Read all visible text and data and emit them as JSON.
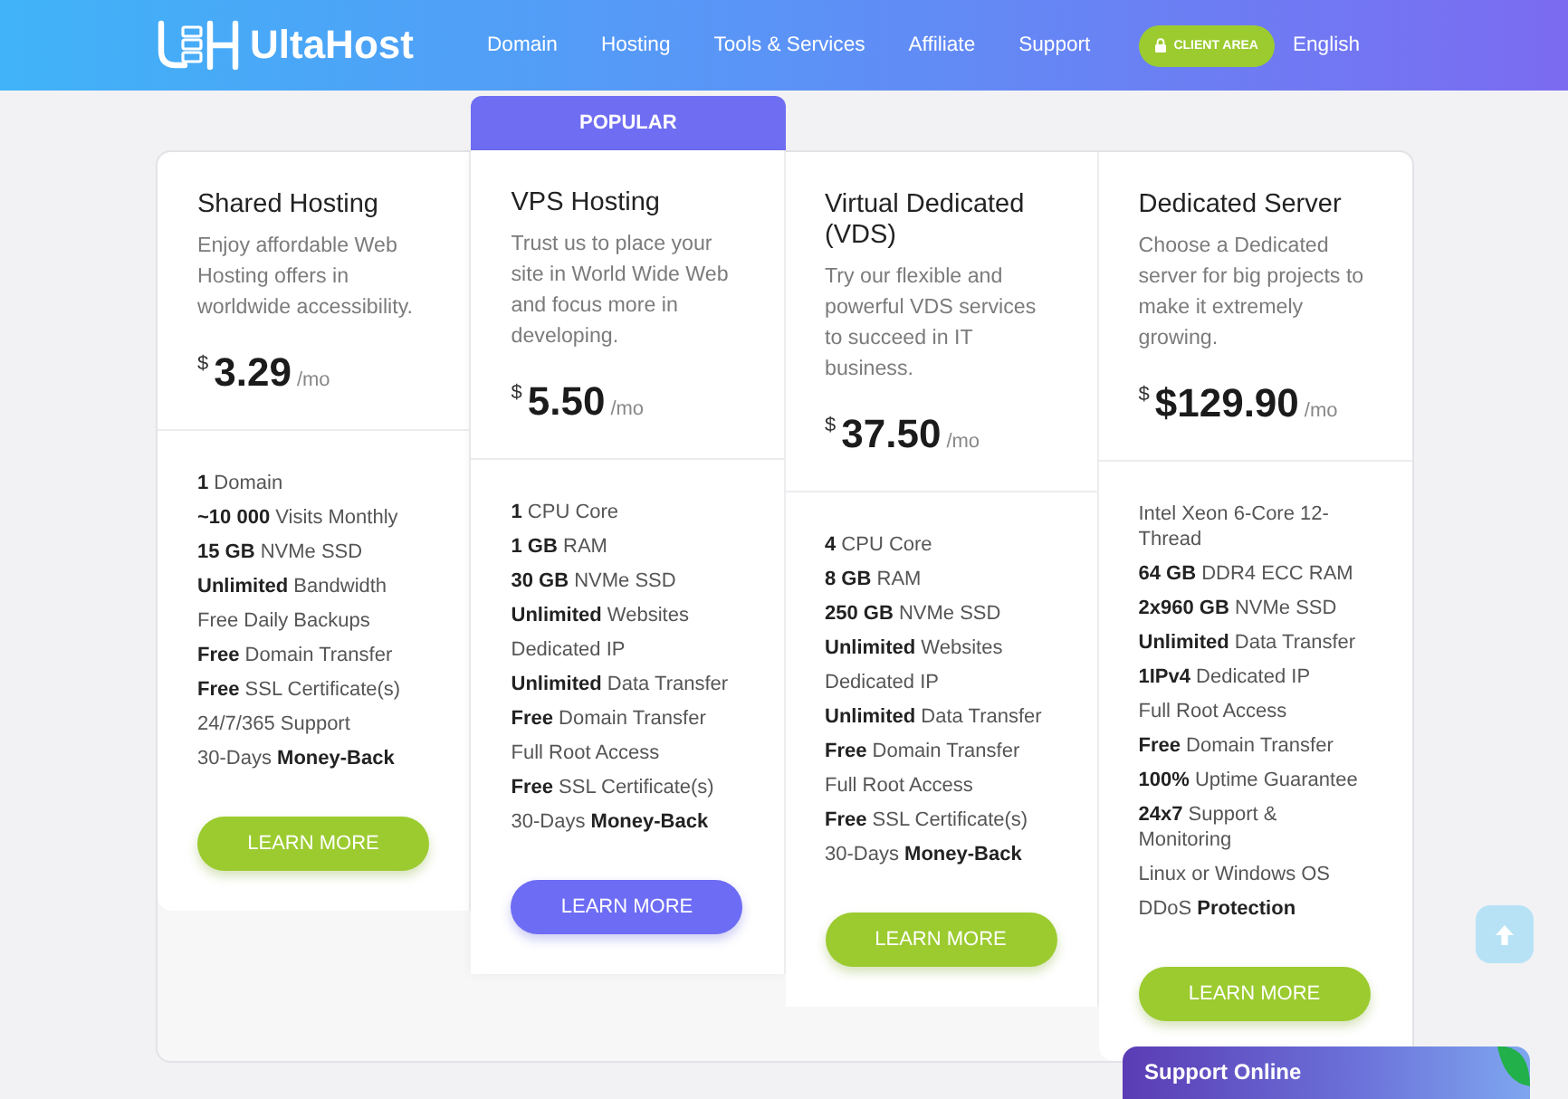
{
  "header": {
    "logo_text": "UltaHost",
    "nav": [
      "Domain",
      "Hosting",
      "Tools & Services",
      "Affiliate",
      "Support"
    ],
    "client_area": "CLIENT AREA",
    "language": "English"
  },
  "plans": [
    {
      "title": "Shared Hosting",
      "description": "Enjoy affordable Web Hosting offers in worldwide accessibility.",
      "currency": "$",
      "price": "3.29",
      "period": "/mo",
      "popular": false,
      "features": [
        "**1** Domain",
        "**~10 000** Visits Monthly",
        "**15 GB** NVMe SSD",
        "**Unlimited** Bandwidth",
        "Free Daily Backups",
        "**Free** Domain Transfer",
        "**Free** SSL Certificate(s)",
        "24/7/365 Support",
        "30-Days **Money-Back**"
      ],
      "button": "LEARN MORE"
    },
    {
      "title": "VPS Hosting",
      "badge": "POPULAR",
      "description": "Trust us to place your site in World Wide Web and focus more in developing.",
      "currency": "$",
      "price": "5.50",
      "period": "/mo",
      "popular": true,
      "features": [
        "**1** CPU Core",
        "**1 GB** RAM",
        "**30 GB** NVMe SSD",
        "**Unlimited** Websites",
        "Dedicated IP",
        "**Unlimited** Data Transfer",
        "**Free** Domain Transfer",
        "Full Root Access",
        "**Free** SSL Certificate(s)",
        "30-Days **Money-Back**"
      ],
      "button": "LEARN MORE"
    },
    {
      "title": "Virtual Dedicated (VDS)",
      "description": "Try our flexible and powerful VDS services to succeed in IT business.",
      "currency": "$",
      "price": "37.50",
      "period": "/mo",
      "popular": false,
      "features": [
        "**4** CPU Core",
        "**8 GB** RAM",
        "**250 GB** NVMe SSD",
        "**Unlimited** Websites",
        "Dedicated IP",
        "**Unlimited** Data Transfer",
        "**Free** Domain Transfer",
        "Full Root Access",
        "**Free** SSL Certificate(s)",
        "30-Days **Money-Back**"
      ],
      "button": "LEARN MORE"
    },
    {
      "title": "Dedicated Server",
      "description": "Choose a Dedicated server for big projects to make it extremely growing.",
      "currency": "$",
      "price": "$129.90",
      "period": "/mo",
      "popular": false,
      "features": [
        "Intel Xeon 6-Core 12-Thread",
        "**64 GB** DDR4 ECC RAM",
        "**2x960 GB** NVMe SSD",
        "**Unlimited** Data Transfer",
        "**1IPv4** Dedicated IP",
        "Full Root Access",
        "**Free** Domain Transfer",
        "**100%** Uptime Guarantee",
        "**24x7** Support & Monitoring",
        "Linux or Windows OS",
        "DDoS **Protection**"
      ],
      "button": "LEARN MORE"
    }
  ],
  "chat": {
    "label": "Support Online"
  }
}
